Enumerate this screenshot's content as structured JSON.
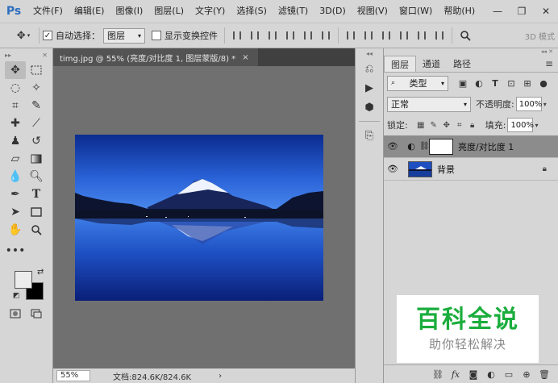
{
  "app": {
    "logo": "Ps"
  },
  "menu": [
    "文件(F)",
    "编辑(E)",
    "图像(I)",
    "图层(L)",
    "文字(Y)",
    "选择(S)",
    "滤镜(T)",
    "3D(D)",
    "视图(V)",
    "窗口(W)",
    "帮助(H)"
  ],
  "window_controls": {
    "minimize": "—",
    "restore": "❐",
    "close": "✕"
  },
  "options": {
    "auto_select_label": "自动选择：",
    "auto_select_checked": true,
    "auto_select_target": "图层",
    "show_transform_label": "显示变换控件",
    "show_transform_checked": false,
    "mode_3d_label": "3D 模式"
  },
  "document": {
    "tab_title": "timg.jpg @ 55% (亮度/对比度 1, 图层蒙版/8) *",
    "tab_close": "×",
    "zoom": "55%",
    "doc_info": "文档:824.6K/824.6K",
    "status_arrow": "›"
  },
  "layers_panel": {
    "tabs": [
      "图层",
      "通道",
      "路径"
    ],
    "active_tab": 0,
    "filter_kind": "类型",
    "blend_mode": "正常",
    "opacity_label": "不透明度:",
    "opacity_value": "100%",
    "lock_label": "锁定:",
    "fill_label": "填充:",
    "fill_value": "100%",
    "layers": [
      {
        "name": "亮度/对比度 1",
        "type": "adjustment",
        "selected": true,
        "visible": true
      },
      {
        "name": "背景",
        "type": "image",
        "selected": false,
        "visible": true,
        "locked": true
      }
    ]
  },
  "watermark": {
    "title": "百科全说",
    "subtitle": "助你轻松解决"
  },
  "colors": {
    "foreground": "#ececec",
    "background": "#000000",
    "ui_gray": "#d6d6d6",
    "canvas_gray": "#707070",
    "watermark_green": "#1aad3c"
  }
}
